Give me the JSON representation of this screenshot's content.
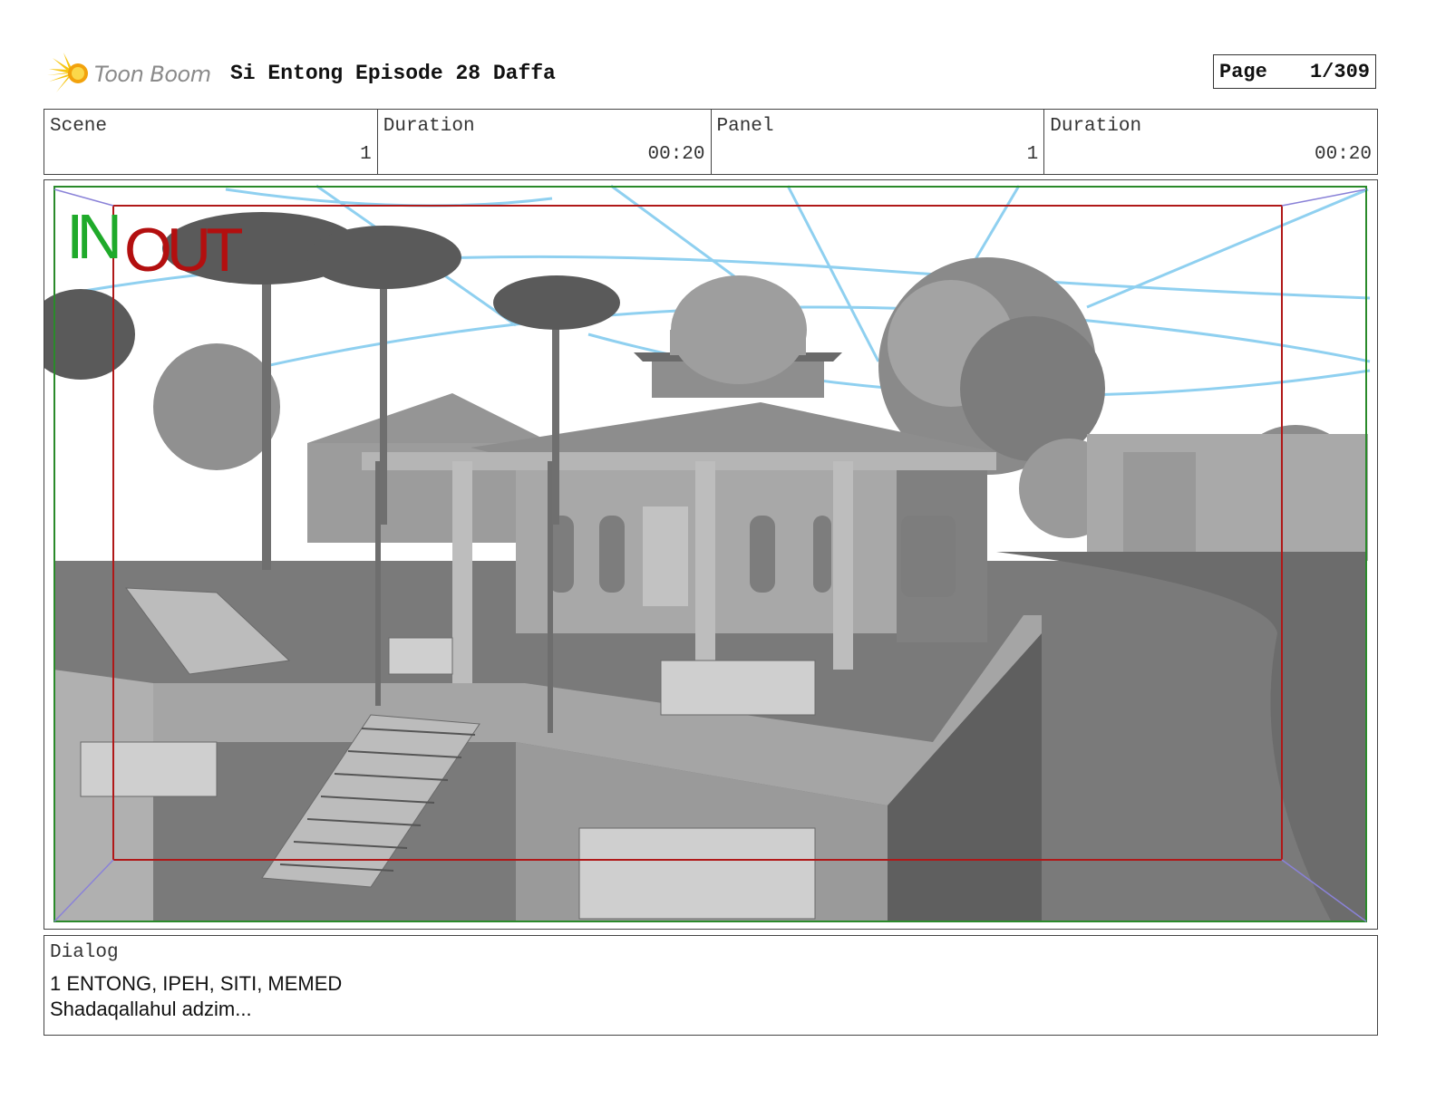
{
  "header": {
    "logo_text": "Toon Boom",
    "title": "Si Entong Episode 28 Daffa",
    "page_label": "Page",
    "page_value": "1/309"
  },
  "info": {
    "scene_label": "Scene",
    "scene_value": "1",
    "scene_duration_label": "Duration",
    "scene_duration_value": "00:20",
    "panel_label": "Panel",
    "panel_value": "1",
    "panel_duration_label": "Duration",
    "panel_duration_value": "00:20"
  },
  "panel": {
    "in_label": "IN",
    "out_label": "OUT",
    "colors": {
      "in": "#1faa2a",
      "out": "#b30f0f",
      "guide": "#8fd0f0",
      "frame_outer": "#2a8a2a",
      "frame_inner": "#b01818"
    }
  },
  "dialog": {
    "label": "Dialog",
    "line1": "1 ENTONG, IPEH, SITI, MEMED",
    "line2": "Shadaqallahul adzim..."
  }
}
